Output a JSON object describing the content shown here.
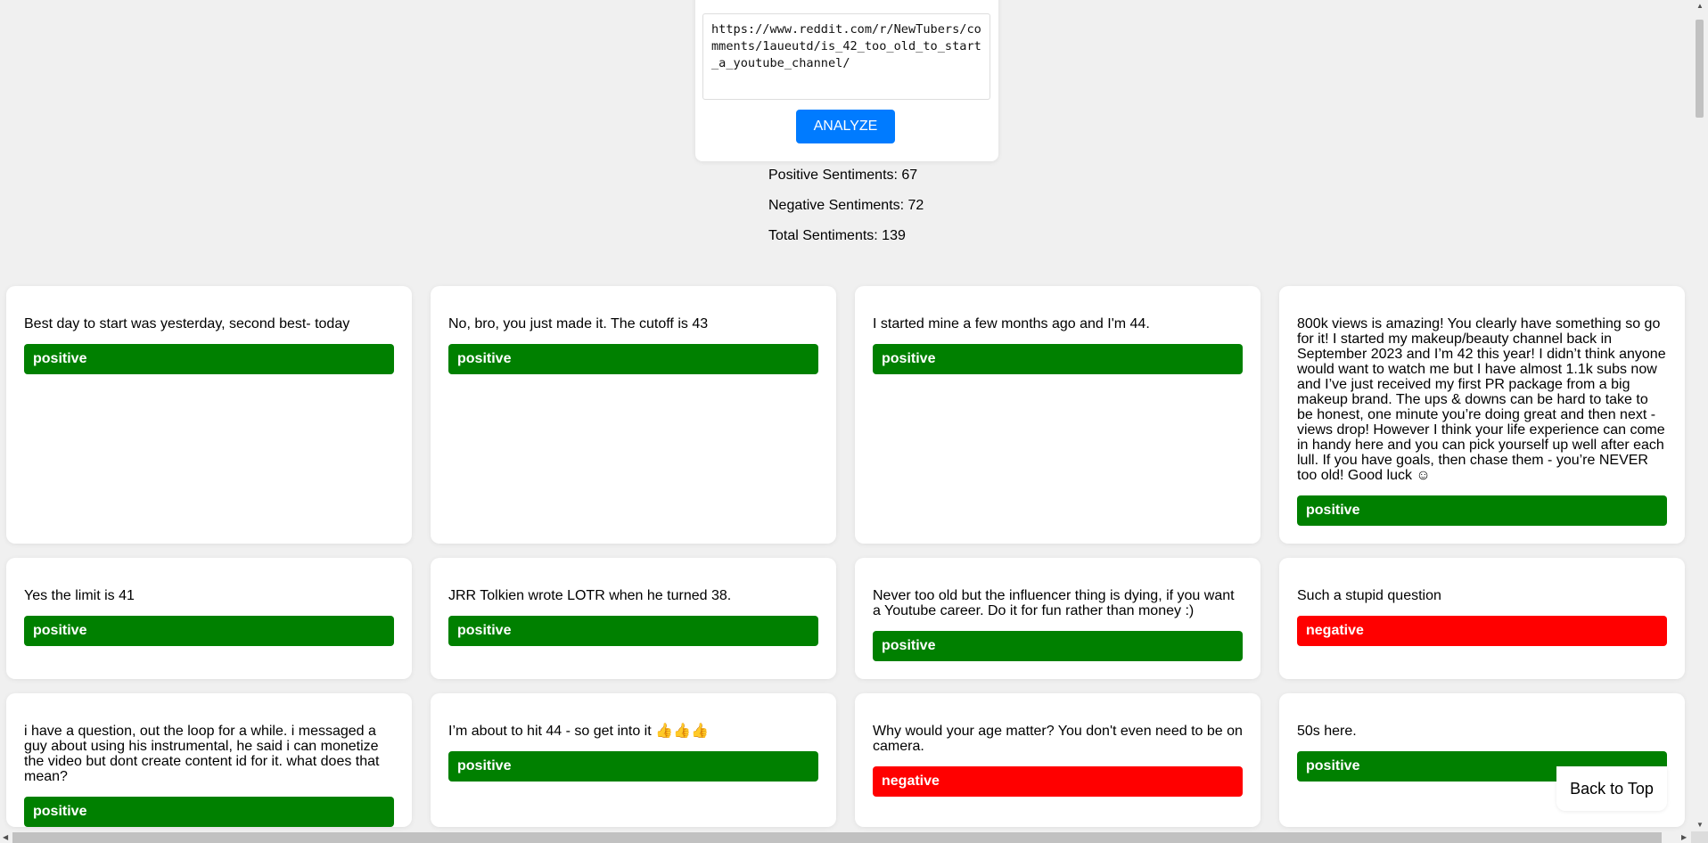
{
  "form": {
    "url_value": "https://www.reddit.com/r/NewTubers/comments/1aueutd/is_42_too_old_to_start_a_youtube_channel/",
    "analyze_label": "ANALYZE"
  },
  "stats": {
    "positive": "Positive Sentiments: 67",
    "negative": "Negative Sentiments: 72",
    "total": "Total Sentiments: 139"
  },
  "colors": {
    "positive": "#008000",
    "negative": "#ff0000",
    "button": "#007bff"
  },
  "comments": [
    {
      "text": "Best day to start was yesterday, second best- today",
      "sentiment": "positive"
    },
    {
      "text": "No, bro, you just made it. The cutoff is 43",
      "sentiment": "positive"
    },
    {
      "text": "I started mine a few months ago and I'm 44.",
      "sentiment": "positive"
    },
    {
      "text": "800k views is amazing! You clearly have something so go for it! I started my makeup/beauty channel back in September 2023 and I’m 42 this year! I didn’t think anyone would want to watch me but I have almost 1.1k subs now and I’ve just received my first PR package from a big makeup brand. The ups & downs can be hard to take to be honest, one minute you’re doing great and then next - views drop! However I think your life experience can come in handy here and you can pick yourself up well after each lull. If you have goals, then chase them - you’re NEVER too old! Good luck ☺",
      "sentiment": "positive"
    },
    {
      "text": "Yes the limit is 41",
      "sentiment": "positive"
    },
    {
      "text": "JRR Tolkien wrote LOTR when he turned 38.",
      "sentiment": "positive"
    },
    {
      "text": "Never too old but the influencer thing is dying, if you want a Youtube career. Do it for fun rather than money :)",
      "sentiment": "positive"
    },
    {
      "text": "Such a stupid question",
      "sentiment": "negative"
    },
    {
      "text": "i have a question, out the loop for a while. i messaged a guy about using his instrumental, he said i can monetize the video but dont create content id for it. what does that mean?",
      "sentiment": "positive"
    },
    {
      "text": "I’m about to hit 44 - so get into it 👍👍👍",
      "sentiment": "positive"
    },
    {
      "text": "Why would your age matter? You don't even need to be on camera.",
      "sentiment": "negative"
    },
    {
      "text": "50s here.",
      "sentiment": "positive"
    }
  ],
  "back_to_top_label": "Back to Top"
}
